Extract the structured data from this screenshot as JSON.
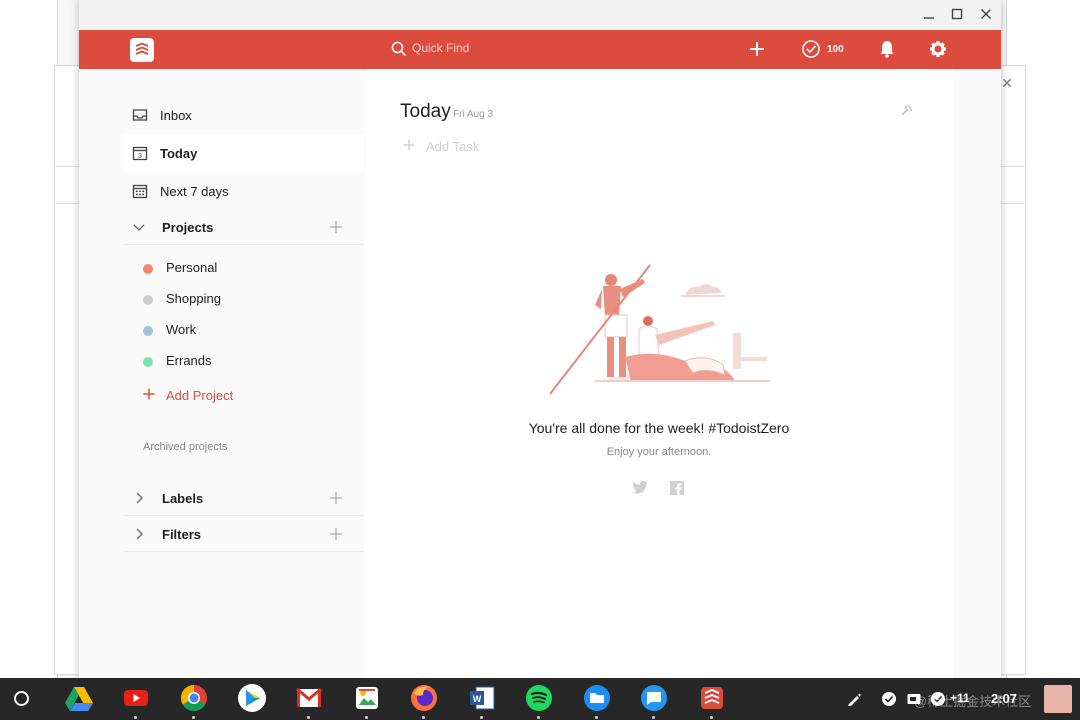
{
  "header": {
    "search_placeholder": "Quick Find",
    "karma_count": "100"
  },
  "sidebar": {
    "nav_items": [
      {
        "label": "Inbox",
        "icon": "inbox-icon"
      },
      {
        "label": "Today",
        "icon": "calendar-today-icon",
        "day": "3",
        "active": true
      },
      {
        "label": "Next 7 days",
        "icon": "calendar-week-icon"
      }
    ],
    "projects_label": "Projects",
    "projects": [
      {
        "label": "Personal",
        "color": "#f08c6a"
      },
      {
        "label": "Shopping",
        "color": "#cccccc"
      },
      {
        "label": "Work",
        "color": "#9fc3d3"
      },
      {
        "label": "Errands",
        "color": "#7ddfb3"
      }
    ],
    "add_project_label": "Add Project",
    "archived_label": "Archived projects",
    "labels_label": "Labels",
    "filters_label": "Filters"
  },
  "main": {
    "title": "Today",
    "date": "Fri Aug 3",
    "add_task_label": "Add Task",
    "empty_heading": "You're all done for the week! #TodoistZero",
    "empty_sub": "Enjoy your afternoon."
  },
  "taskbar": {
    "apps": [
      "google-drive-icon",
      "youtube-icon",
      "chrome-icon",
      "play-store-icon",
      "gmail-icon",
      "photos-icon",
      "firefox-icon",
      "word-icon",
      "spotify-icon",
      "files-icon",
      "messages-icon",
      "todoist-icon"
    ],
    "notification_count": "+11",
    "time": "2:07",
    "watermark": "@稀土掘金技术社区"
  },
  "colors": {
    "brand": "#db4c3f",
    "taskbar": "#272727"
  }
}
